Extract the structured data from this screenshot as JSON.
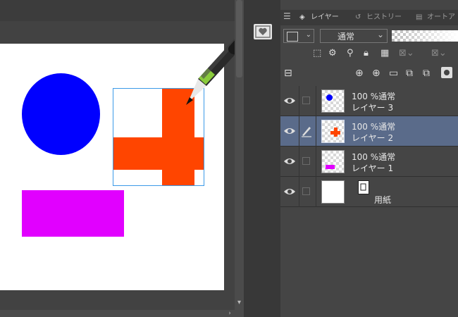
{
  "panel": {
    "tabs": [
      {
        "label": "レイヤー",
        "icon": "layers-icon"
      },
      {
        "label": "ヒストリー",
        "icon": "history-icon"
      },
      {
        "label": "オートア",
        "icon": "auto-action-icon"
      }
    ],
    "blend_mode": "通常"
  },
  "layers": [
    {
      "opacity_mode": "100 %通常",
      "name": "レイヤー 3",
      "thumb": "blue-circle",
      "visible": true,
      "selected": false
    },
    {
      "opacity_mode": "100 %通常",
      "name": "レイヤー 2",
      "thumb": "orange-cross",
      "visible": true,
      "selected": true
    },
    {
      "opacity_mode": "100 %通常",
      "name": "レイヤー 1",
      "thumb": "magenta-rect",
      "visible": true,
      "selected": false
    },
    {
      "opacity_mode": "",
      "name": "用紙",
      "thumb": "white-paper",
      "visible": true,
      "selected": false
    }
  ],
  "colors": {
    "blue": "#0000ff",
    "orange": "#ff4500",
    "magenta": "#e100ff",
    "selection": "#5a6b8a",
    "selection_border": "#3b9ae8"
  }
}
